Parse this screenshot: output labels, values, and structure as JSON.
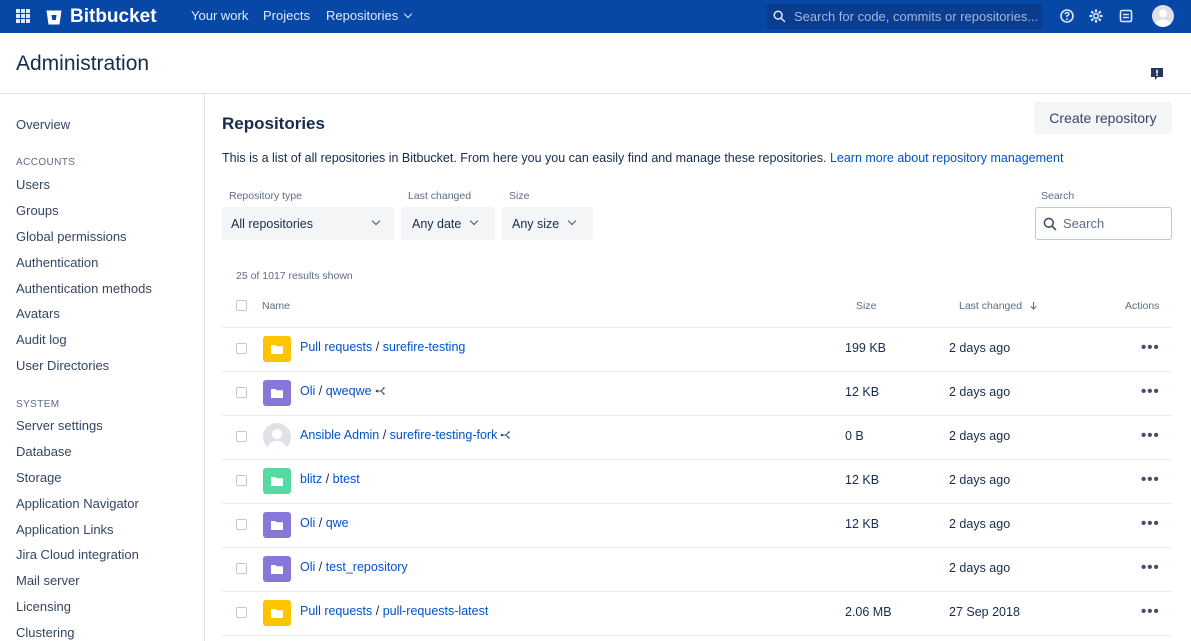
{
  "nav": {
    "app_name": "Bitbucket",
    "links": [
      "Your work",
      "Projects",
      "Repositories"
    ],
    "search_placeholder": "Search for code, commits or repositories..."
  },
  "header": {
    "title": "Administration"
  },
  "sidebar": {
    "overview": "Overview",
    "accounts_heading": "ACCOUNTS",
    "accounts": [
      "Users",
      "Groups",
      "Global permissions",
      "Authentication",
      "Authentication methods",
      "Avatars",
      "Audit log",
      "User Directories"
    ],
    "system_heading": "SYSTEM",
    "system": [
      "Server settings",
      "Database",
      "Storage",
      "Application Navigator",
      "Application Links",
      "Jira Cloud integration",
      "Mail server",
      "Licensing",
      "Clustering"
    ]
  },
  "main": {
    "title": "Repositories",
    "create_button": "Create repository",
    "description": "This is a list of all repositories in Bitbucket. From here you you can easily find and manage these repositories.",
    "learn_more": "Learn more about repository management",
    "filters": {
      "type_label": "Repository type",
      "type_value": "All repositories",
      "changed_label": "Last changed",
      "changed_value": "Any date",
      "size_label": "Size",
      "size_value": "Any size",
      "search_label": "Search",
      "search_placeholder": "Search"
    },
    "results_text": "25 of 1017 results shown",
    "columns": {
      "name": "Name",
      "size": "Size",
      "last_changed": "Last changed",
      "actions": "Actions"
    },
    "sort_icon": "arrow-down-icon",
    "rows": [
      {
        "project": "Pull requests",
        "repo": "surefire-testing",
        "size": "199 KB",
        "changed": "2 days ago",
        "icon": "folder",
        "color": "#ffc400",
        "fork": false
      },
      {
        "project": "Oli",
        "repo": "qweqwe",
        "size": "12 KB",
        "changed": "2 days ago",
        "icon": "folder",
        "color": "#8777d9",
        "fork": true
      },
      {
        "project": "Ansible Admin",
        "repo": "surefire-testing-fork",
        "size": "0 B",
        "changed": "2 days ago",
        "icon": "avatar",
        "color": "#dfe1e6",
        "fork": true
      },
      {
        "project": "blitz",
        "repo": "btest",
        "size": "12 KB",
        "changed": "2 days ago",
        "icon": "folder",
        "color": "#57d9a3",
        "fork": false
      },
      {
        "project": "Oli",
        "repo": "qwe",
        "size": "12 KB",
        "changed": "2 days ago",
        "icon": "folder",
        "color": "#8777d9",
        "fork": false
      },
      {
        "project": "Oli",
        "repo": "test_repository",
        "size": "",
        "changed": "2 days ago",
        "icon": "folder",
        "color": "#8777d9",
        "fork": false
      },
      {
        "project": "Pull requests",
        "repo": "pull-requests-latest",
        "size": "2.06 MB",
        "changed": "27 Sep 2018",
        "icon": "folder",
        "color": "#ffc400",
        "fork": false
      }
    ],
    "more_label": "•••"
  }
}
